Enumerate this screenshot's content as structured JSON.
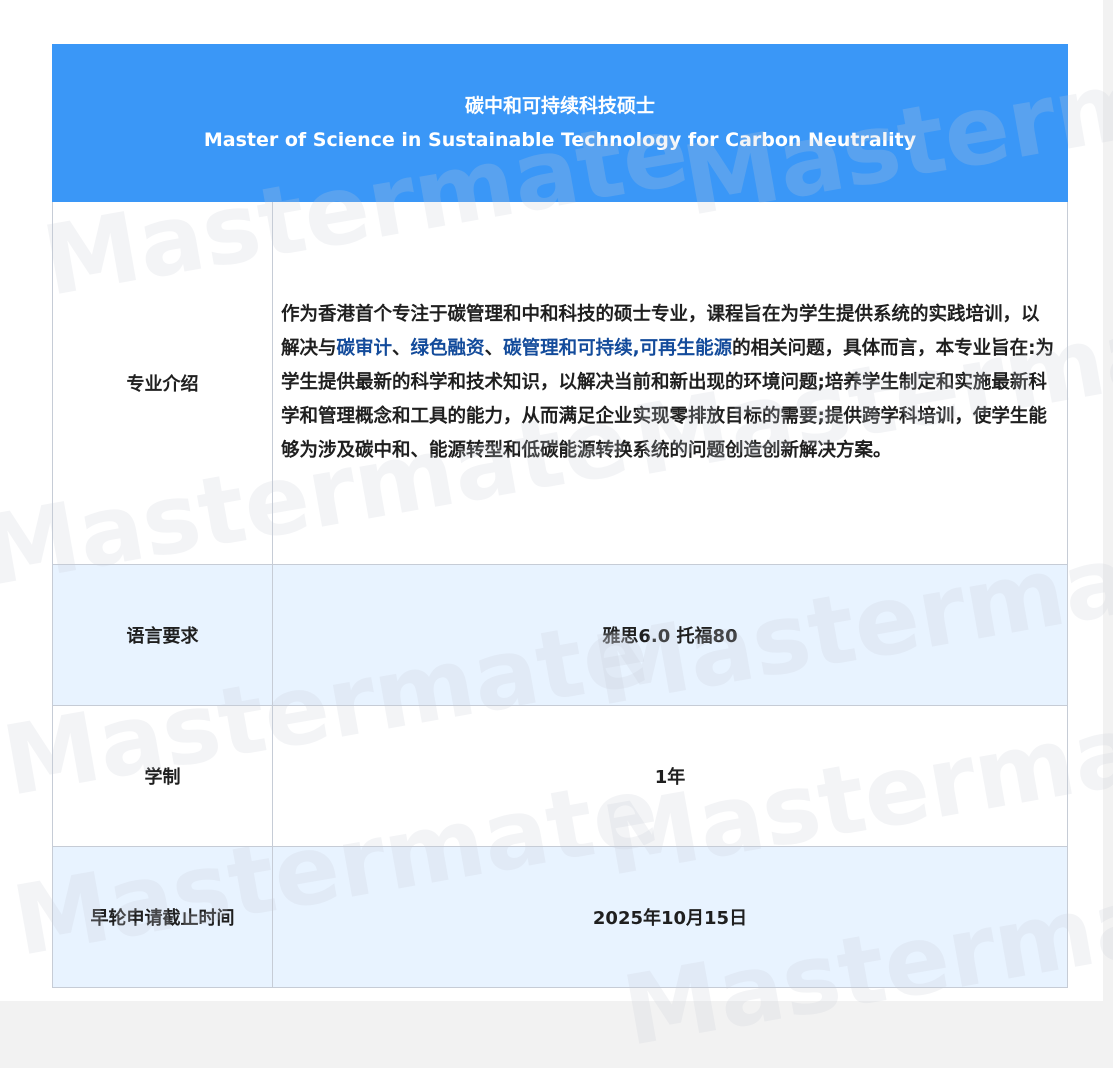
{
  "header": {
    "title_cn": "碳中和可持续科技硕士",
    "title_en": "Master of Science in Sustainable Technology for Carbon Neutrality"
  },
  "watermark": "Mastermate",
  "rows": {
    "intro": {
      "label": "专业介绍",
      "parts": [
        "作为香港首个专注于碳管理和中和科技的硕士专业，课程旨在为学生提供系统的实践培训，以解决与",
        "碳审计",
        "、",
        "绿色融资",
        "、",
        "碳管理和可持续",
        ",",
        "可再生能源",
        "的相关问题，具体而言，本专业旨在:为学生提供最新的科学和技术知识，以解决当前和新出现的环境问题;培养学生制定和实施最新科学和管理概念和工具的能力，从而满足企业实现零排放目标的需要;提供跨学科培训，使学生能够为涉及碳中和、能源转型和低碳能源转换系统的问题创造创新解决方案。"
      ]
    },
    "language": {
      "label": "语言要求",
      "value": "雅思6.0 托福80"
    },
    "duration": {
      "label": "学制",
      "value": "1年"
    },
    "deadline": {
      "label": "早轮申请截止时间",
      "value": "2025年10月15日"
    }
  },
  "colors": {
    "header_bg": "#3a97f7",
    "row_blue_bg": "#e8f3ff",
    "highlight_text": "#134b9b",
    "border": "#c6ccd6"
  }
}
